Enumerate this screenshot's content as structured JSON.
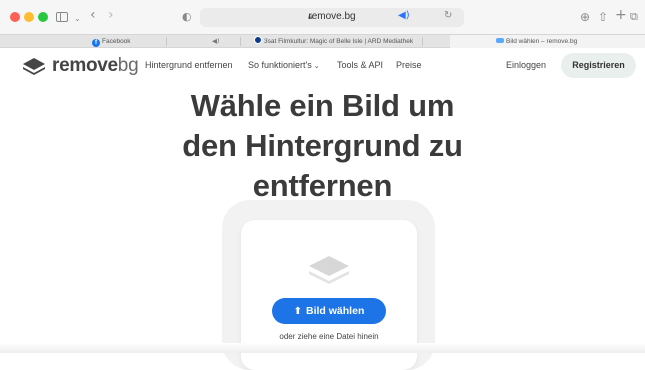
{
  "browser": {
    "url": "remove.bg",
    "tabs": [
      {
        "label": "Facebook",
        "icon": "facebook-icon"
      },
      {
        "label": "",
        "icon": "speaker-icon"
      },
      {
        "label": "3sat Filmkultur: Magic of Belle Isle | ARD Mediathek",
        "icon": "ard-icon"
      },
      {
        "label": "",
        "icon": "blank"
      },
      {
        "label": "Bild wählen – remove.bg",
        "icon": "removebg-icon"
      }
    ]
  },
  "nav": {
    "logo_bold": "remove",
    "logo_light": "bg",
    "links": [
      "Hintergrund entfernen",
      "So funktioniert's",
      "Tools & API",
      "Preise"
    ],
    "login": "Einloggen",
    "register": "Registrieren"
  },
  "hero": {
    "lines": [
      "Wähle ein Bild um",
      "den Hintergrund zu",
      "entfernen"
    ]
  },
  "upload": {
    "button": "Bild wählen",
    "hint": "oder ziehe eine Datei hinein"
  },
  "colors": {
    "accent": "#1d74e6",
    "register_bg": "#e9efed",
    "text": "#3b3b3b"
  }
}
